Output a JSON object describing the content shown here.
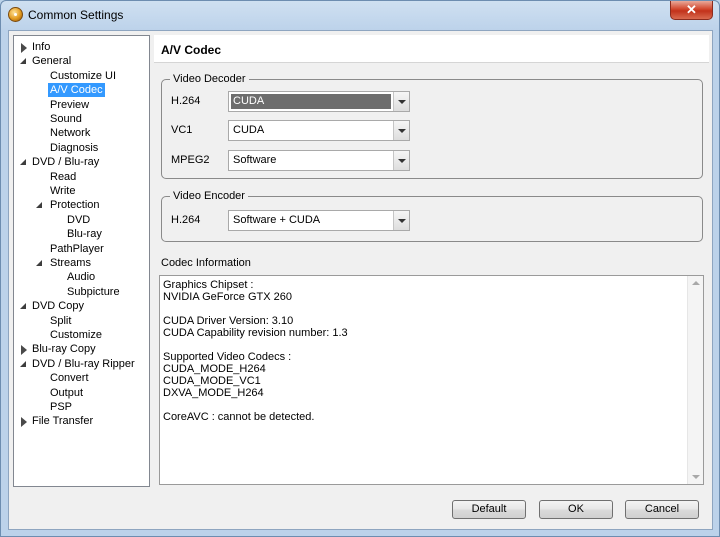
{
  "window": {
    "title": "Common Settings",
    "close_glyph": "✕"
  },
  "tree": [
    {
      "label": "Info",
      "level": 0,
      "expander": "collapsed"
    },
    {
      "label": "General",
      "level": 0,
      "expander": "expanded"
    },
    {
      "label": "Customize UI",
      "level": 1,
      "expander": "none"
    },
    {
      "label": "A/V Codec",
      "level": 1,
      "expander": "none",
      "selected": true
    },
    {
      "label": "Preview",
      "level": 1,
      "expander": "none"
    },
    {
      "label": "Sound",
      "level": 1,
      "expander": "none"
    },
    {
      "label": "Network",
      "level": 1,
      "expander": "none"
    },
    {
      "label": "Diagnosis",
      "level": 1,
      "expander": "none"
    },
    {
      "label": "DVD / Blu-ray",
      "level": 0,
      "expander": "expanded"
    },
    {
      "label": "Read",
      "level": 1,
      "expander": "none"
    },
    {
      "label": "Write",
      "level": 1,
      "expander": "none"
    },
    {
      "label": "Protection",
      "level": 1,
      "expander": "expanded"
    },
    {
      "label": "DVD",
      "level": 2,
      "expander": "none"
    },
    {
      "label": "Blu-ray",
      "level": 2,
      "expander": "none"
    },
    {
      "label": "PathPlayer",
      "level": 1,
      "expander": "none"
    },
    {
      "label": "Streams",
      "level": 1,
      "expander": "expanded"
    },
    {
      "label": "Audio",
      "level": 2,
      "expander": "none"
    },
    {
      "label": "Subpicture",
      "level": 2,
      "expander": "none"
    },
    {
      "label": "DVD Copy",
      "level": 0,
      "expander": "expanded"
    },
    {
      "label": "Split",
      "level": 1,
      "expander": "none"
    },
    {
      "label": "Customize",
      "level": 1,
      "expander": "none"
    },
    {
      "label": "Blu-ray Copy",
      "level": 0,
      "expander": "collapsed"
    },
    {
      "label": "DVD / Blu-ray Ripper",
      "level": 0,
      "expander": "expanded"
    },
    {
      "label": "Convert",
      "level": 1,
      "expander": "none"
    },
    {
      "label": "Output",
      "level": 1,
      "expander": "none"
    },
    {
      "label": "PSP",
      "level": 1,
      "expander": "none"
    },
    {
      "label": "File Transfer",
      "level": 0,
      "expander": "collapsed"
    }
  ],
  "panel": {
    "title": "A/V Codec",
    "decoder": {
      "label": "Video Decoder",
      "h264_label": "H.264",
      "h264_value": "CUDA",
      "vc1_label": "VC1",
      "vc1_value": "CUDA",
      "mpeg2_label": "MPEG2",
      "mpeg2_value": "Software"
    },
    "encoder": {
      "label": "Video Encoder",
      "h264_label": "H.264",
      "h264_value": "Software + CUDA"
    },
    "codec_info": {
      "label": "Codec Information",
      "lines": [
        "Graphics Chipset :",
        "NVIDIA GeForce GTX 260",
        "",
        "CUDA Driver Version: 3.10",
        "CUDA Capability revision number: 1.3",
        "",
        "Supported Video Codecs :",
        "CUDA_MODE_H264",
        "CUDA_MODE_VC1",
        "DXVA_MODE_H264",
        "",
        "CoreAVC : cannot be detected."
      ]
    }
  },
  "buttons": {
    "default": "Default",
    "ok": "OK",
    "cancel": "Cancel"
  }
}
